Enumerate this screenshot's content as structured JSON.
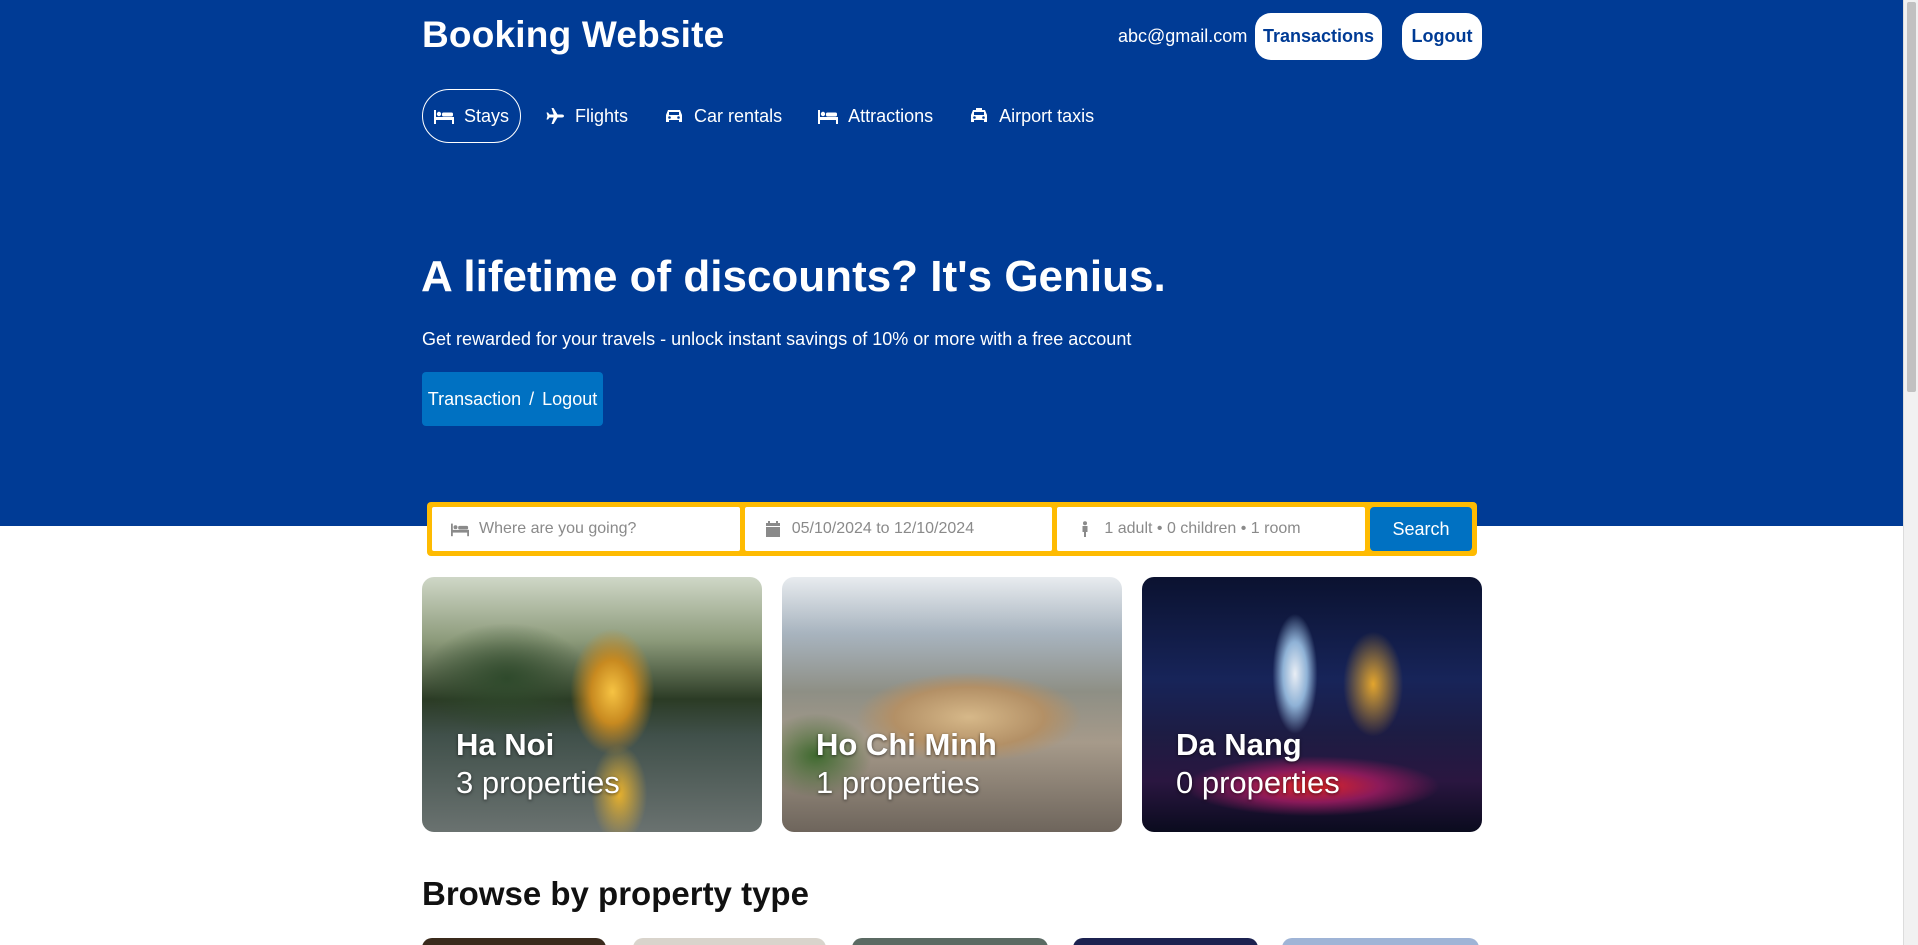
{
  "header": {
    "brand": "Booking Website",
    "user_email": "abc@gmail.com",
    "transactions_label": "Transactions",
    "logout_label": "Logout"
  },
  "nav": {
    "items": [
      {
        "label": "Stays",
        "icon": "bed-icon",
        "active": true
      },
      {
        "label": "Flights",
        "icon": "plane-icon"
      },
      {
        "label": "Car rentals",
        "icon": "car-icon"
      },
      {
        "label": "Attractions",
        "icon": "bed-icon"
      },
      {
        "label": "Airport taxis",
        "icon": "taxi-icon"
      }
    ]
  },
  "hero": {
    "headline": "A lifetime of discounts? It's Genius.",
    "subline": "Get rewarded for your travels - unlock instant savings of 10% or more with a free account",
    "button_left": "Transaction",
    "button_sep": "/",
    "button_right": "Logout"
  },
  "search": {
    "destination_placeholder": "Where are you going?",
    "dates": "05/10/2024 to 12/10/2024",
    "guests": "1 adult • 0 children • 1 room",
    "button_label": "Search"
  },
  "cities": [
    {
      "name": "Ha Noi",
      "properties": "3 properties"
    },
    {
      "name": "Ho Chi Minh",
      "properties": "1 properties"
    },
    {
      "name": "Da Nang",
      "properties": "0 properties"
    }
  ],
  "property_types": {
    "title": "Browse by property type"
  },
  "colors": {
    "primary": "#003b95",
    "accent": "#0071c2",
    "search_border": "#febb02"
  }
}
